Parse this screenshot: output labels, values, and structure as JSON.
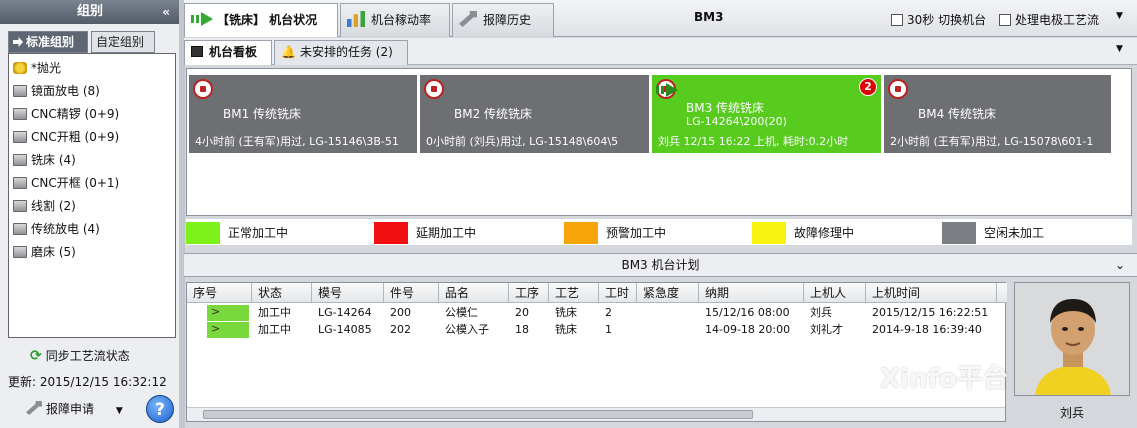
{
  "left": {
    "title": "组别",
    "collapse": "«",
    "tabs": [
      "标准组别",
      "自定组别"
    ],
    "groups": [
      {
        "label": "*抛光",
        "icon": "star-folder-icon"
      },
      {
        "label": "镜面放电 (8)",
        "icon": "machine-icon"
      },
      {
        "label": "CNC精锣 (0+9)",
        "icon": "machine-icon"
      },
      {
        "label": "CNC开粗 (0+9)",
        "icon": "machine-icon"
      },
      {
        "label": "铣床 (4)",
        "icon": "machine-icon"
      },
      {
        "label": "CNC开框 (0+1)",
        "icon": "machine-icon"
      },
      {
        "label": "线割 (2)",
        "icon": "machine-icon"
      },
      {
        "label": "传统放电 (4)",
        "icon": "machine-icon"
      },
      {
        "label": "磨床 (5)",
        "icon": "machine-icon"
      }
    ],
    "sync": "同步工艺流状态",
    "updated": "更新: 2015/12/15 16:32:12",
    "report": "报障申请",
    "help": "?"
  },
  "top": {
    "tabs": [
      "【铣床】 机台状况",
      "机台稼动率",
      "报障历史"
    ],
    "machine": "BM3",
    "check1": "30秒 切换机台",
    "check2": "处理电极工艺流",
    "menu": "▼"
  },
  "sub": {
    "tabs": [
      "机台看板",
      "未安排的任务 (2)"
    ]
  },
  "machines": [
    {
      "name": "BM1 传统铣床",
      "sub": "",
      "foot": "4小时前 (王有军)用过, LG-15146\\3B-51",
      "status": "idle",
      "badge": ""
    },
    {
      "name": "BM2 传统铣床",
      "sub": "",
      "foot": "0小时前 (刘兵)用过, LG-15148\\604\\5",
      "status": "idle",
      "badge": ""
    },
    {
      "name": "BM3 传统铣床",
      "sub": "LG-14264\\200(20)",
      "foot": "刘兵 12/15 16:22 上机, 耗时:0.2小时",
      "status": "normal",
      "badge": "2"
    },
    {
      "name": "BM4 传统铣床",
      "sub": "",
      "foot": "2小时前 (王有军)用过, LG-15078\\601-1",
      "status": "idle",
      "badge": ""
    }
  ],
  "legend": [
    {
      "label": "正常加工中",
      "color": "#7cf21a"
    },
    {
      "label": "延期加工中",
      "color": "#f20f0f"
    },
    {
      "label": "预警加工中",
      "color": "#f7a30a"
    },
    {
      "label": "故障修理中",
      "color": "#f7f20f"
    },
    {
      "label": "空闲未加工",
      "color": "#7b7e82"
    }
  ],
  "plan": {
    "title": "BM3 机台计划",
    "columns": [
      "序号",
      "状态",
      "模号",
      "件号",
      "品名",
      "工序",
      "工艺",
      "工时",
      "紧急度",
      "纳期",
      "上机人",
      "上机时间"
    ],
    "rows": [
      [
        "",
        "加工中",
        "LG-14264",
        "200",
        "公模仁",
        "20",
        "铣床",
        "2",
        "",
        "15/12/16 08:00",
        "刘兵",
        "2015/12/15 16:22:51"
      ],
      [
        "",
        "加工中",
        "LG-14085",
        "202",
        "公模入子",
        "18",
        "铣床",
        "1",
        "",
        "14-09-18 20:00",
        "刘礼才",
        "2014-9-18 16:39:40"
      ]
    ]
  },
  "operator": "刘兵",
  "watermark": "Xinfo平台",
  "colors": {
    "normal": "#57cc1e",
    "idle": "#6d6f72"
  }
}
